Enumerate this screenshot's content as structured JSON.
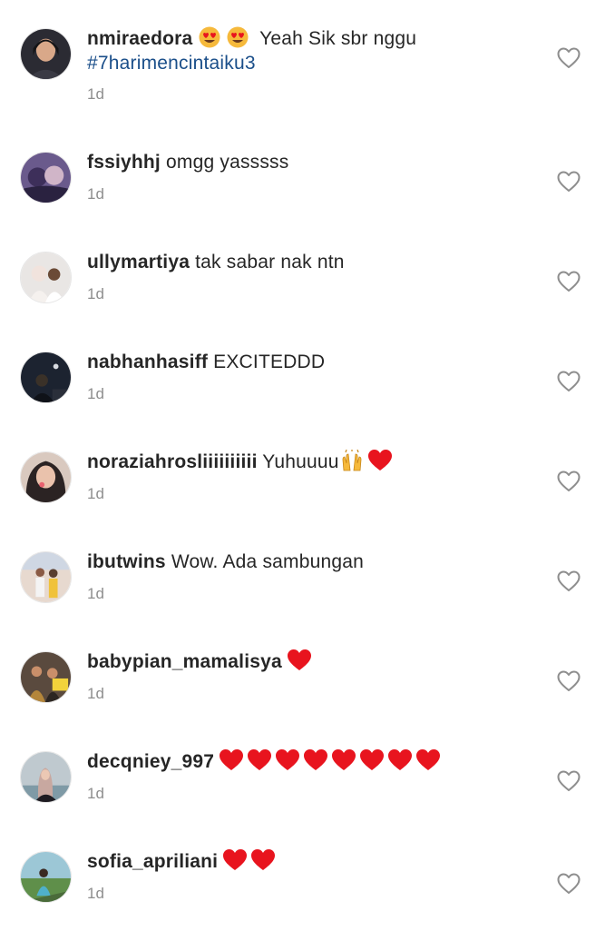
{
  "comments": [
    {
      "username": "nmiraedora",
      "text": "Yeah Sik sbr nggu",
      "emoji_before_text": [
        "smiling-face-heart-eyes",
        "smiling-face-heart-eyes"
      ],
      "hashtag": "#7harimencintaiku3",
      "time": "1d"
    },
    {
      "username": "fssiyhhj",
      "text": "omgg yasssss",
      "time": "1d"
    },
    {
      "username": "ullymartiya",
      "text": "tak sabar nak ntn",
      "time": "1d"
    },
    {
      "username": "nabhanhasiff",
      "text": "EXCITEDDD",
      "time": "1d"
    },
    {
      "username": "noraziahrosliiiiiiiiii",
      "text": "Yuhuuuu",
      "emoji_after_text": [
        "raising-hands",
        "red-heart"
      ],
      "time": "1d"
    },
    {
      "username": "ibutwins",
      "text": "Wow. Ada sambungan",
      "time": "1d"
    },
    {
      "username": "babypian_mamalisya",
      "text": "",
      "emoji_after_text": [
        "red-heart"
      ],
      "time": "1d"
    },
    {
      "username": "decqniey_997",
      "text": "",
      "emoji_after_text": [
        "red-heart",
        "red-heart",
        "red-heart",
        "red-heart",
        "red-heart",
        "red-heart",
        "red-heart",
        "red-heart"
      ],
      "time": "1d"
    },
    {
      "username": "sofia_apriliani",
      "text": "",
      "emoji_after_text": [
        "red-heart",
        "red-heart"
      ],
      "time": "1d"
    }
  ],
  "icons": {
    "like": "heart-outline-icon",
    "heart_eyes": "smiling-face-heart-eyes-emoji",
    "raising_hands": "raising-hands-emoji",
    "red_heart": "red-heart-emoji"
  },
  "colors": {
    "username": "#262626",
    "hashtag": "#1b4f8a",
    "timestamp": "#8e8e8e",
    "like_icon": "#8e8e8e",
    "heart_emoji": "#e8141e",
    "heart_eyes_face": "#f6b93b"
  }
}
